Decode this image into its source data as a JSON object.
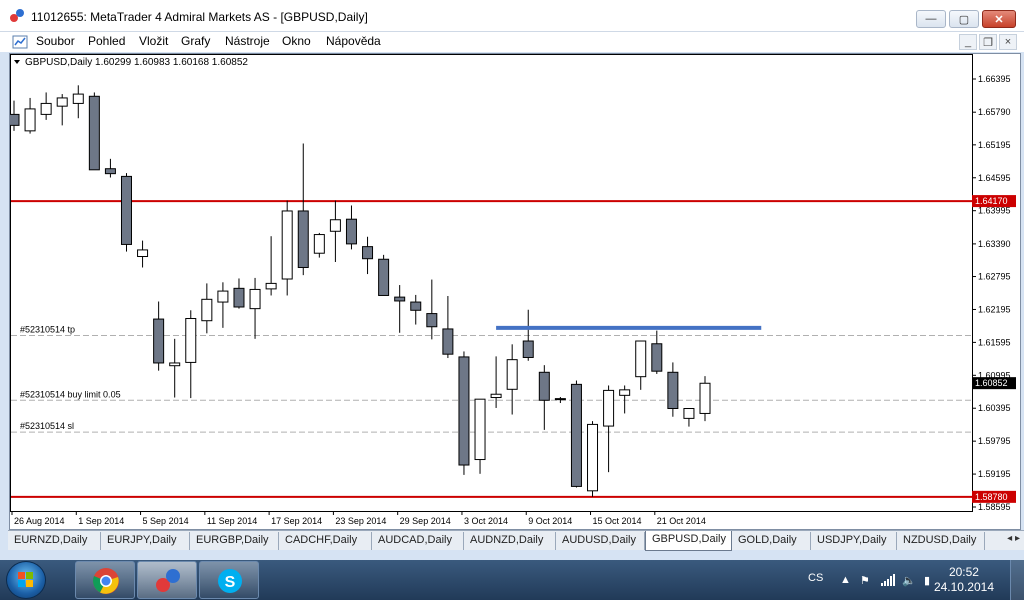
{
  "window": {
    "title": "11012655: MetaTrader 4 Admiral Markets AS - [GBPUSD,Daily]",
    "min_symbol": "—",
    "max_symbol": "▢",
    "close_symbol": "✕"
  },
  "menu": [
    "Soubor",
    "Pohled",
    "Vložit",
    "Grafy",
    "Nástroje",
    "Okno",
    "Nápověda"
  ],
  "mdi_buttons": {
    "min": "_",
    "restore": "❐",
    "close": "×"
  },
  "chart": {
    "header": "GBPUSD,Daily  1.60299 1.60983 1.60168 1.60852",
    "colors": {
      "bear": "#6e7787",
      "bull": "#ffffff",
      "outline": "#000",
      "hline": "#cc0000",
      "trend": "#4472c4",
      "grid": "#b0b0b0"
    }
  },
  "chart_data": {
    "type": "candlestick",
    "symbol": "GBPUSD",
    "timeframe": "Daily",
    "y_ticks": [
      1.66395,
      1.6579,
      1.65195,
      1.64595,
      1.63995,
      1.6339,
      1.62795,
      1.62195,
      1.61595,
      1.60995,
      1.60395,
      1.59795,
      1.59195,
      1.58595
    ],
    "y_tick_labels": [
      "1.66395",
      "1.65790",
      "1.65195",
      "1.64595",
      "1.63995",
      "1.63390",
      "1.62795",
      "1.62195",
      "1.61595",
      "1.60995",
      "1.60395",
      "1.59795",
      "1.59195",
      "1.58595"
    ],
    "x_labels": [
      "26 Aug 2014",
      "1 Sep 2014",
      "5 Sep 2014",
      "11 Sep 2014",
      "17 Sep 2014",
      "23 Sep 2014",
      "29 Sep 2014",
      "3 Oct 2014",
      "9 Oct 2014",
      "15 Oct 2014",
      "21 Oct 2014"
    ],
    "ylim": [
      1.5845,
      1.6665
    ],
    "price_labels": [
      {
        "value": 1.6417,
        "text": "1.64170",
        "color": "#cc0000"
      },
      {
        "value": 1.5878,
        "text": "1.58780",
        "color": "#cc0000"
      },
      {
        "value": 1.60852,
        "text": "1.60852",
        "color": "#000000"
      }
    ],
    "horizontal_lines": [
      1.6417,
      1.5878
    ],
    "trend_line": {
      "from_index": 30,
      "to_index": 46.5,
      "value": 1.6186
    },
    "dashed_levels": [
      {
        "label": "#52310514 tp",
        "value": 1.6172
      },
      {
        "label": "#52310514 buy limit 0.05",
        "value": 1.6054
      },
      {
        "label": "#52310514 sl",
        "value": 1.5996
      }
    ],
    "candles": [
      {
        "o": 1.6575,
        "h": 1.66,
        "l": 1.6545,
        "c": 1.6555
      },
      {
        "o": 1.6545,
        "h": 1.6605,
        "l": 1.654,
        "c": 1.6585
      },
      {
        "o": 1.6575,
        "h": 1.6615,
        "l": 1.6565,
        "c": 1.6595
      },
      {
        "o": 1.659,
        "h": 1.6612,
        "l": 1.6555,
        "c": 1.6605
      },
      {
        "o": 1.6595,
        "h": 1.6628,
        "l": 1.6568,
        "c": 1.6612
      },
      {
        "o": 1.6608,
        "h": 1.6615,
        "l": 1.6475,
        "c": 1.6474
      },
      {
        "o": 1.6476,
        "h": 1.6494,
        "l": 1.646,
        "c": 1.6467
      },
      {
        "o": 1.6462,
        "h": 1.6468,
        "l": 1.6325,
        "c": 1.6338
      },
      {
        "o": 1.6316,
        "h": 1.6345,
        "l": 1.6296,
        "c": 1.6328
      },
      {
        "o": 1.6202,
        "h": 1.6234,
        "l": 1.6108,
        "c": 1.6122
      },
      {
        "o": 1.6117,
        "h": 1.6166,
        "l": 1.6059,
        "c": 1.6122
      },
      {
        "o": 1.6123,
        "h": 1.6218,
        "l": 1.6058,
        "c": 1.6203
      },
      {
        "o": 1.6199,
        "h": 1.6267,
        "l": 1.6176,
        "c": 1.6238
      },
      {
        "o": 1.6233,
        "h": 1.6269,
        "l": 1.6186,
        "c": 1.6253
      },
      {
        "o": 1.6258,
        "h": 1.6276,
        "l": 1.6221,
        "c": 1.6224
      },
      {
        "o": 1.6221,
        "h": 1.6277,
        "l": 1.6166,
        "c": 1.6256
      },
      {
        "o": 1.6257,
        "h": 1.6353,
        "l": 1.6245,
        "c": 1.6267
      },
      {
        "o": 1.6275,
        "h": 1.6418,
        "l": 1.6245,
        "c": 1.6399
      },
      {
        "o": 1.6399,
        "h": 1.6522,
        "l": 1.6282,
        "c": 1.6296
      },
      {
        "o": 1.6322,
        "h": 1.6359,
        "l": 1.6314,
        "c": 1.6356
      },
      {
        "o": 1.6362,
        "h": 1.6418,
        "l": 1.6306,
        "c": 1.6383
      },
      {
        "o": 1.6384,
        "h": 1.6409,
        "l": 1.6329,
        "c": 1.6339
      },
      {
        "o": 1.6334,
        "h": 1.6352,
        "l": 1.6284,
        "c": 1.6312
      },
      {
        "o": 1.6311,
        "h": 1.6319,
        "l": 1.6247,
        "c": 1.6245
      },
      {
        "o": 1.6242,
        "h": 1.6264,
        "l": 1.6177,
        "c": 1.6235
      },
      {
        "o": 1.6233,
        "h": 1.6246,
        "l": 1.6192,
        "c": 1.6218
      },
      {
        "o": 1.6212,
        "h": 1.6274,
        "l": 1.6165,
        "c": 1.6188
      },
      {
        "o": 1.6184,
        "h": 1.6244,
        "l": 1.6131,
        "c": 1.6138
      },
      {
        "o": 1.6133,
        "h": 1.6143,
        "l": 1.5918,
        "c": 1.5936
      },
      {
        "o": 1.5946,
        "h": 1.6056,
        "l": 1.592,
        "c": 1.6056
      },
      {
        "o": 1.6059,
        "h": 1.6134,
        "l": 1.604,
        "c": 1.6065
      },
      {
        "o": 1.6074,
        "h": 1.6156,
        "l": 1.6028,
        "c": 1.6128
      },
      {
        "o": 1.6162,
        "h": 1.6219,
        "l": 1.6126,
        "c": 1.6132
      },
      {
        "o": 1.6105,
        "h": 1.6118,
        "l": 1.6,
        "c": 1.6054
      },
      {
        "o": 1.6057,
        "h": 1.606,
        "l": 1.6049,
        "c": 1.6056
      },
      {
        "o": 1.6083,
        "h": 1.609,
        "l": 1.5895,
        "c": 1.5897
      },
      {
        "o": 1.5889,
        "h": 1.6016,
        "l": 1.5878,
        "c": 1.601
      },
      {
        "o": 1.6007,
        "h": 1.6081,
        "l": 1.5923,
        "c": 1.6072
      },
      {
        "o": 1.6063,
        "h": 1.6081,
        "l": 1.603,
        "c": 1.6073
      },
      {
        "o": 1.6097,
        "h": 1.6157,
        "l": 1.6073,
        "c": 1.6162
      },
      {
        "o": 1.6157,
        "h": 1.6181,
        "l": 1.6102,
        "c": 1.6107
      },
      {
        "o": 1.6105,
        "h": 1.6123,
        "l": 1.6024,
        "c": 1.6039
      },
      {
        "o": 1.6021,
        "h": 1.6036,
        "l": 1.6006,
        "c": 1.6039
      },
      {
        "o": 1.603,
        "h": 1.6098,
        "l": 1.6016,
        "c": 1.6085
      }
    ]
  },
  "tabs": [
    "EURNZD,Daily",
    "EURJPY,Daily",
    "EURGBP,Daily",
    "CADCHF,Daily",
    "AUDCAD,Daily",
    "AUDNZD,Daily",
    "AUDUSD,Daily",
    "GBPUSD,Daily",
    "GOLD,Daily",
    "USDJPY,Daily",
    "NZDUSD,Daily"
  ],
  "active_tab": "GBPUSD,Daily",
  "taskbar": {
    "lang": "CS",
    "time": "20:52",
    "date": "24.10.2014",
    "apps": [
      "chrome-icon",
      "metatrader-icon",
      "skype-icon"
    ]
  }
}
